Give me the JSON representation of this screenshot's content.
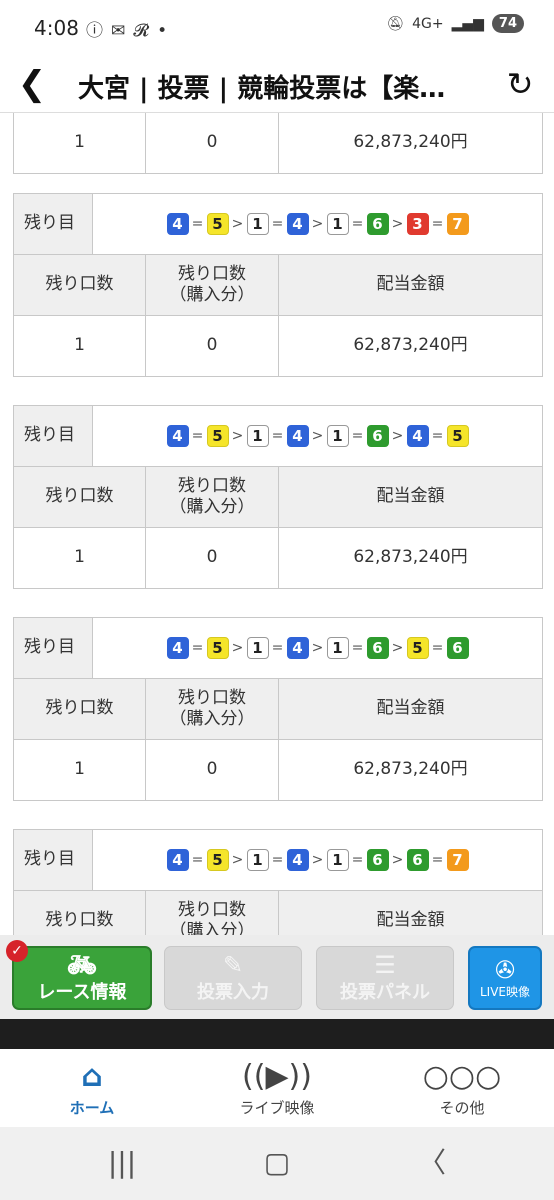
{
  "status_bar": {
    "time": "4:08",
    "network": "4G+",
    "battery": "74"
  },
  "header": {
    "title": "大宮 | 投票 | 競輪投票は【楽…"
  },
  "table_labels": {
    "zanme": "残り目",
    "col1": "残り口数",
    "col2_line1": "残り口数",
    "col2_line2": "（購入分）",
    "col3": "配当金額"
  },
  "top_partial": {
    "v1": "1",
    "v2": "0",
    "v3": "62,873,240円"
  },
  "blocks": [
    {
      "combo": [
        "4",
        "=",
        "5",
        ">",
        "1",
        "=",
        "4",
        ">",
        "1",
        "=",
        "6",
        ">",
        "3",
        "=",
        "7"
      ],
      "v1": "1",
      "v2": "0",
      "v3": "62,873,240円"
    },
    {
      "combo": [
        "4",
        "=",
        "5",
        ">",
        "1",
        "=",
        "4",
        ">",
        "1",
        "=",
        "6",
        ">",
        "4",
        "=",
        "5"
      ],
      "v1": "1",
      "v2": "0",
      "v3": "62,873,240円"
    },
    {
      "combo": [
        "4",
        "=",
        "5",
        ">",
        "1",
        "=",
        "4",
        ">",
        "1",
        "=",
        "6",
        ">",
        "5",
        "=",
        "6"
      ],
      "v1": "1",
      "v2": "0",
      "v3": "62,873,240円"
    },
    {
      "combo": [
        "4",
        "=",
        "5",
        ">",
        "1",
        "=",
        "4",
        ">",
        "1",
        "=",
        "6",
        ">",
        "6",
        "=",
        "7"
      ]
    }
  ],
  "num_colors": {
    "1": {
      "bg": "#ffffff",
      "fg": "#222222",
      "border": "#999999"
    },
    "3": {
      "bg": "#e03a2f",
      "fg": "#ffffff",
      "border": "#e03a2f"
    },
    "4": {
      "bg": "#2f63d8",
      "fg": "#ffffff",
      "border": "#2f63d8"
    },
    "5": {
      "bg": "#f5e52a",
      "fg": "#222222",
      "border": "#d6c820"
    },
    "6": {
      "bg": "#2e9b2e",
      "fg": "#ffffff",
      "border": "#2e9b2e"
    },
    "7": {
      "bg": "#f39a1c",
      "fg": "#ffffff",
      "border": "#f39a1c"
    }
  },
  "buttons": {
    "race_info": "レース情報",
    "vote_input": "投票入力",
    "vote_panel": "投票パネル",
    "live_video": "LIVE映像"
  },
  "tabs": {
    "home": "ホーム",
    "live": "ライブ映像",
    "other": "その他"
  }
}
